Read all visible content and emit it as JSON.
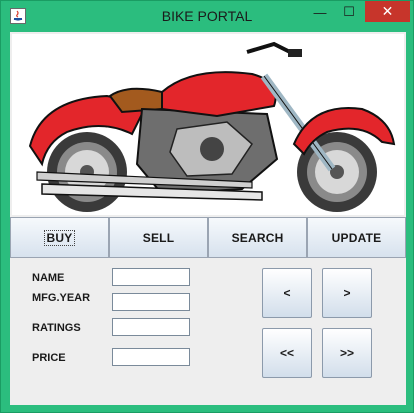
{
  "window": {
    "title": "BIKE PORTAL",
    "min_glyph": "—",
    "max_glyph": "☐",
    "close_glyph": "✕"
  },
  "tabs": [
    {
      "label": "BUY"
    },
    {
      "label": "SELL"
    },
    {
      "label": "SEARCH"
    },
    {
      "label": "UPDATE"
    }
  ],
  "form": {
    "name_label": "NAME",
    "mfg_label": "MFG.YEAR",
    "ratings_label": "RATINGS",
    "price_label": "PRICE",
    "name_value": "",
    "mfg_value": "",
    "ratings_value": "",
    "price_value": ""
  },
  "nav": {
    "prev": "<",
    "next": ">",
    "first": "<<",
    "last": ">>"
  },
  "colors": {
    "accent": "#2bbd7e",
    "close": "#c7352b",
    "bike_red": "#e3262b"
  },
  "image": {
    "icon": "motorcycle-illustration"
  }
}
